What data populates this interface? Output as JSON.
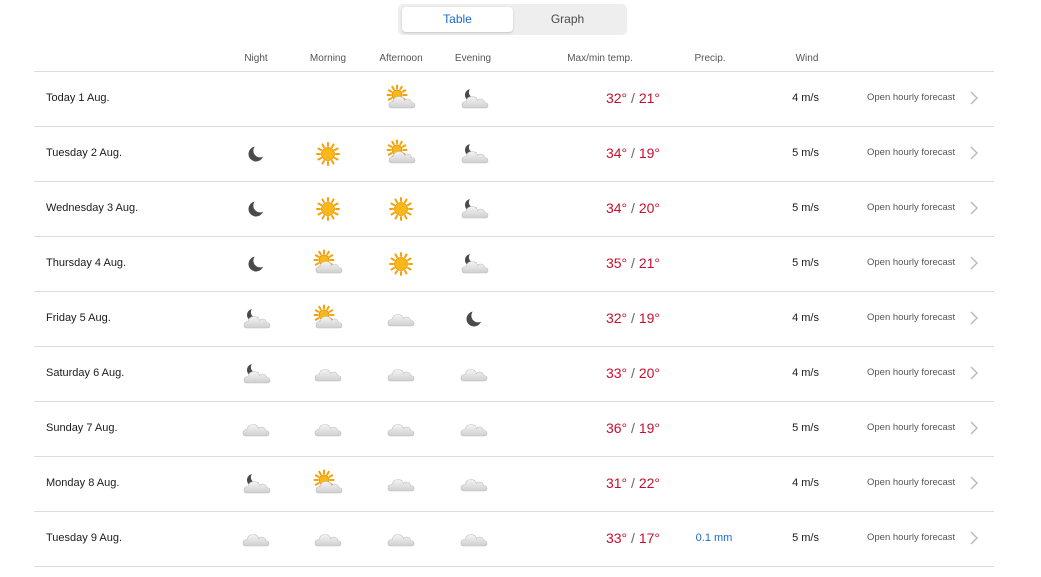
{
  "tabs": {
    "table": "Table",
    "graph": "Graph"
  },
  "headers": {
    "night": "Night",
    "morning": "Morning",
    "afternoon": "Afternoon",
    "evening": "Evening",
    "temp": "Max/min temp.",
    "precip": "Precip.",
    "wind": "Wind"
  },
  "link_label": "Open hourly forecast",
  "colors": {
    "accent": "#1b6ac9",
    "temp": "#c8102e",
    "divider": "#dcdcdc"
  },
  "rows": [
    {
      "day": "Today 1 Aug.",
      "icons": [
        "",
        "",
        "partly-cloudy-day-icon",
        "partly-cloudy-night-icon"
      ],
      "max": "32°",
      "min": "21°",
      "precip": "",
      "wind": "4 m/s"
    },
    {
      "day": "Tuesday 2 Aug.",
      "icons": [
        "moon-icon",
        "sun-icon",
        "partly-cloudy-day-icon",
        "partly-cloudy-night-icon"
      ],
      "max": "34°",
      "min": "19°",
      "precip": "",
      "wind": "5 m/s"
    },
    {
      "day": "Wednesday 3 Aug.",
      "icons": [
        "moon-icon",
        "sun-icon",
        "sun-icon",
        "partly-cloudy-night-icon"
      ],
      "max": "34°",
      "min": "20°",
      "precip": "",
      "wind": "5 m/s"
    },
    {
      "day": "Thursday 4 Aug.",
      "icons": [
        "moon-icon",
        "partly-cloudy-day-icon",
        "sun-icon",
        "partly-cloudy-night-icon"
      ],
      "max": "35°",
      "min": "21°",
      "precip": "",
      "wind": "5 m/s"
    },
    {
      "day": "Friday 5 Aug.",
      "icons": [
        "partly-cloudy-night-icon",
        "partly-cloudy-day-icon",
        "cloud-icon",
        "moon-icon"
      ],
      "max": "32°",
      "min": "19°",
      "precip": "",
      "wind": "4 m/s"
    },
    {
      "day": "Saturday 6 Aug.",
      "icons": [
        "partly-cloudy-night-icon",
        "cloud-icon",
        "cloud-icon",
        "cloud-icon"
      ],
      "max": "33°",
      "min": "20°",
      "precip": "",
      "wind": "4 m/s"
    },
    {
      "day": "Sunday 7 Aug.",
      "icons": [
        "cloud-icon",
        "cloud-icon",
        "cloud-icon",
        "cloud-icon"
      ],
      "max": "36°",
      "min": "19°",
      "precip": "",
      "wind": "5 m/s"
    },
    {
      "day": "Monday 8 Aug.",
      "icons": [
        "partly-cloudy-night-icon",
        "partly-cloudy-day-icon",
        "cloud-icon",
        "cloud-icon"
      ],
      "max": "31°",
      "min": "22°",
      "precip": "",
      "wind": "4 m/s"
    },
    {
      "day": "Tuesday 9 Aug.",
      "icons": [
        "cloud-icon",
        "cloud-icon",
        "cloud-icon",
        "cloud-icon"
      ],
      "max": "33°",
      "min": "17°",
      "precip": "0.1 mm",
      "wind": "5 m/s"
    }
  ]
}
